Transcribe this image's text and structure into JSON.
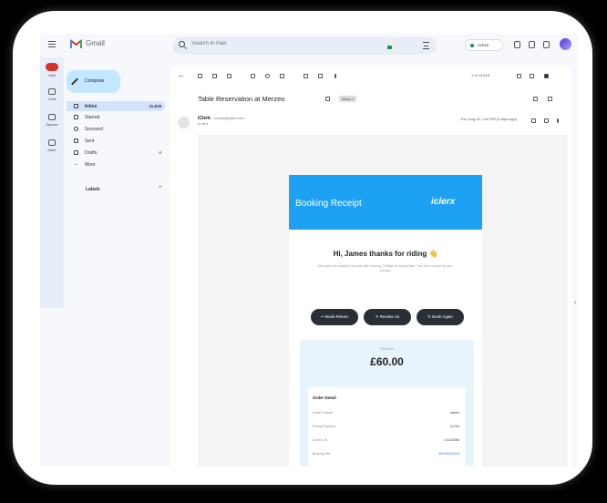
{
  "app": {
    "name": "Gmail"
  },
  "search": {
    "placeholder": "Search in mail"
  },
  "status": {
    "label": "Active"
  },
  "rail": [
    {
      "label": "Mail"
    },
    {
      "label": "Chat"
    },
    {
      "label": "Spaces"
    },
    {
      "label": "Meet"
    }
  ],
  "compose": {
    "label": "Compose"
  },
  "nav": [
    {
      "label": "Inbox",
      "count": "11,818"
    },
    {
      "label": "Starred",
      "count": ""
    },
    {
      "label": "Snoozed",
      "count": ""
    },
    {
      "label": "Sent",
      "count": ""
    },
    {
      "label": "Drafts",
      "count": "6"
    },
    {
      "label": "More",
      "count": ""
    }
  ],
  "labels": {
    "title": "Labels",
    "add": "+"
  },
  "toolbar": {
    "pager": "1 of 12,818"
  },
  "email": {
    "subject": "Table Reservation at Merzeo",
    "tag": "Inbox ×",
    "sender_name": "iClerk",
    "sender_email": "<noreply@iclerk.com>",
    "to": "to me ▾",
    "date": "Thu, Aug 15, 1:00 PM (3 days ago)"
  },
  "receipt": {
    "title": "Booking Receipt",
    "brand": "iclerx",
    "greeting": "Hi, James thanks for riding 👋",
    "subtext": "We hope you enjoyed your ride this morning. Thanks for using iClerx. This is an receipt for your journey.",
    "buttons": [
      "↩ Book Return",
      "✕ Review Us",
      "↻ Book Again"
    ],
    "total_label": "Total fare",
    "total": "£60.00",
    "detail_title": "Order Detail",
    "rows": [
      {
        "k": "Driver's Name",
        "v": "James"
      },
      {
        "k": "Receipt Number",
        "v": "#1794"
      },
      {
        "k": "Driver's ID",
        "v": "0.0123456"
      },
      {
        "k": "Booking Ref",
        "v": "MV/2022/1114"
      }
    ]
  },
  "colors": {
    "accent": "#1da1f2",
    "compose_bg": "#c2e7ff",
    "active_nav": "#d3e3fd"
  }
}
